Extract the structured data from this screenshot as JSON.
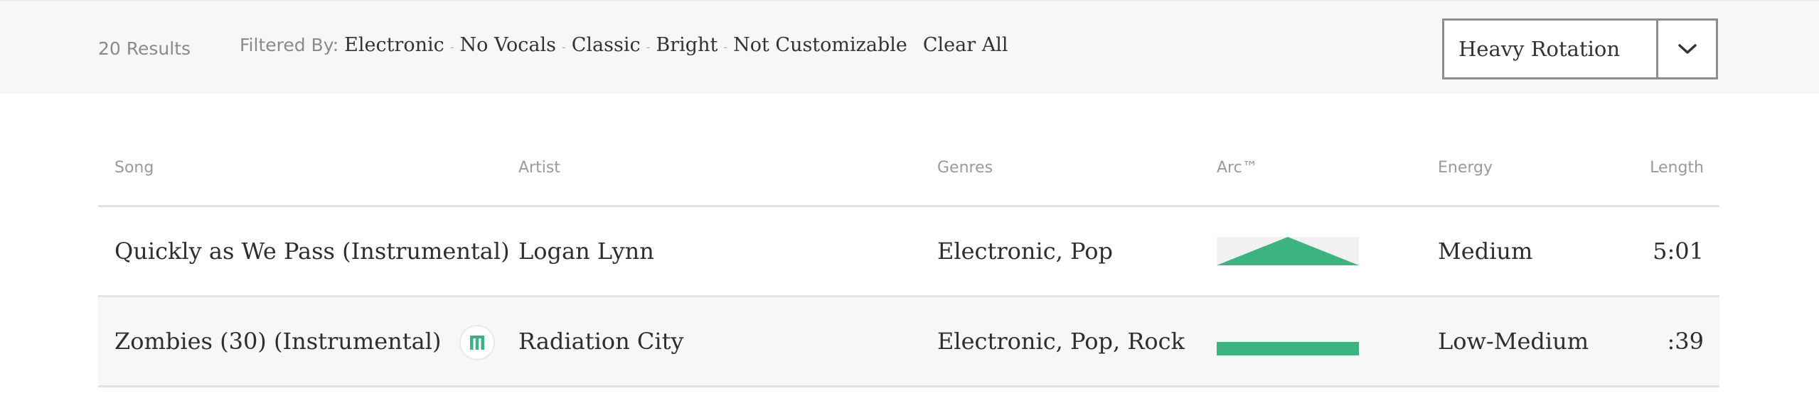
{
  "colors": {
    "accent": "#3db37f",
    "topbar_bg": "#f7f7f7",
    "row_alt_bg": "#f7f7f7"
  },
  "results": {
    "count_label": "20 Results"
  },
  "filters": {
    "label": "Filtered By:",
    "chips": [
      "Electronic",
      "No Vocals",
      "Classic",
      "Bright",
      "Not Customizable"
    ],
    "separator": "-",
    "clear_label": "Clear All"
  },
  "sort": {
    "selected": "Heavy Rotation",
    "toggle_icon": "chevron-down-icon"
  },
  "table": {
    "columns": {
      "song": "Song",
      "artist": "Artist",
      "genres": "Genres",
      "arc": "Arc™",
      "energy": "Energy",
      "length": "Length"
    },
    "rows": [
      {
        "song": "Quickly as We Pass (Instrumental)",
        "artist": "Logan Lynn",
        "genres": "Electronic, Pop",
        "arc_shape": "peak",
        "energy": "Medium",
        "length": "5:01",
        "badge": false
      },
      {
        "song": "Zombies (30) (Instrumental)",
        "artist": "Radiation City",
        "genres": "Electronic, Pop, Rock",
        "arc_shape": "flat",
        "energy": "Low-Medium",
        "length": ":39",
        "badge": true,
        "badge_icon": "marmoset-logo-icon"
      }
    ]
  }
}
